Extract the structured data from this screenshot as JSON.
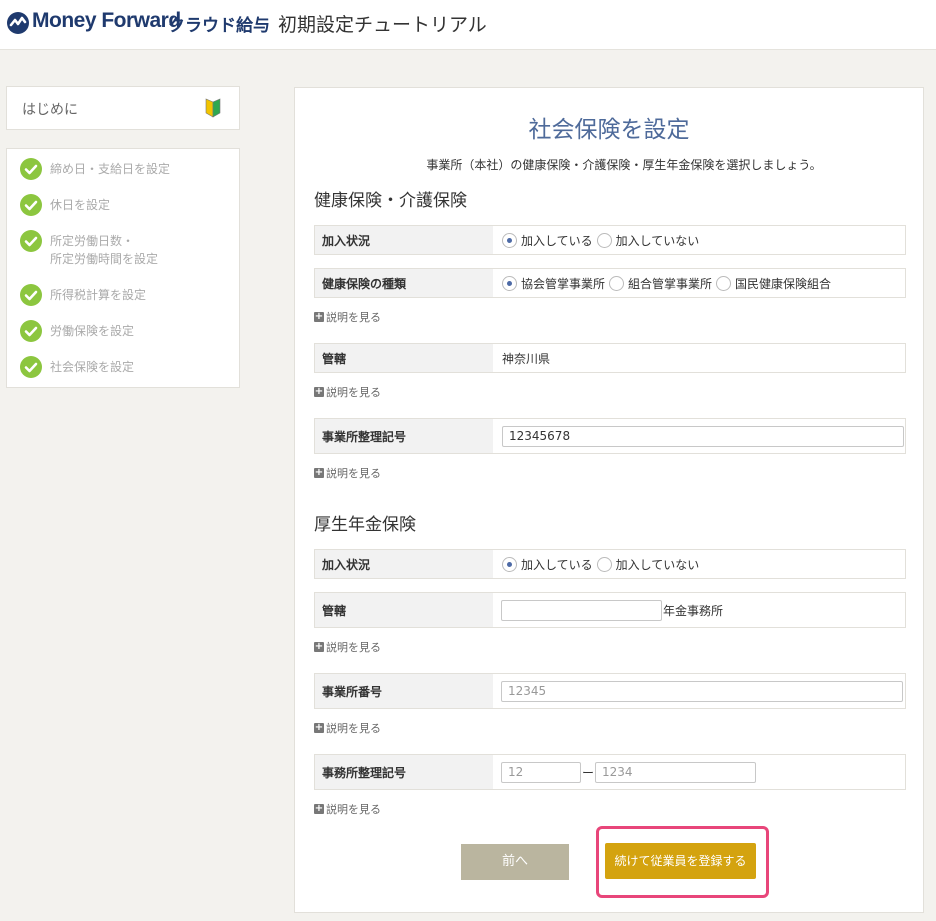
{
  "header": {
    "brand": "Money Forward",
    "product": "クラウド給与",
    "title": "初期設定チュートリアル"
  },
  "sidebar": {
    "intro_label": "はじめに",
    "steps": [
      {
        "label": "締め日・支給日を設定"
      },
      {
        "label": "休日を設定"
      },
      {
        "label": "所定労働日数・",
        "label2": "所定労働時間を設定"
      },
      {
        "label": "所得税計算を設定"
      },
      {
        "label": "労働保険を設定"
      },
      {
        "label": "社会保険を設定"
      }
    ]
  },
  "main": {
    "title": "社会保険を設定",
    "description": "事業所（本社）の健康保険・介護保険・厚生年金保険を選択しましょう。",
    "explain_link": "説明を見る",
    "health": {
      "section_title": "健康保険・介護保険",
      "enrollment_label": "加入状況",
      "enrollment_options": [
        "加入している",
        "加入していない"
      ],
      "type_label": "健康保険の種類",
      "type_options": [
        "協会管掌事業所",
        "組合管掌事業所",
        "国民健康保険組合"
      ],
      "jurisdiction_label": "管轄",
      "jurisdiction_value": "神奈川県",
      "office_code_label": "事業所整理記号",
      "office_code_value": "12345678"
    },
    "pension": {
      "section_title": "厚生年金保険",
      "enrollment_label": "加入状況",
      "enrollment_options": [
        "加入している",
        "加入していない"
      ],
      "jurisdiction_label": "管轄",
      "jurisdiction_suffix": "年金事務所",
      "office_number_label": "事業所番号",
      "office_number_placeholder": "12345",
      "office_code_label": "事務所整理記号",
      "office_code_placeholder_1": "12",
      "office_code_dash": "ー",
      "office_code_placeholder_2": "1234"
    },
    "prev_button": "前へ",
    "next_button": "続けて従業員を登録する"
  },
  "colors": {
    "brand": "#1f3a6e",
    "accent_title": "#4e6a9a",
    "step_done": "#8cc63f",
    "next_button": "#d4a30f",
    "prev_button": "#bab59f",
    "highlight": "#e8467a"
  }
}
